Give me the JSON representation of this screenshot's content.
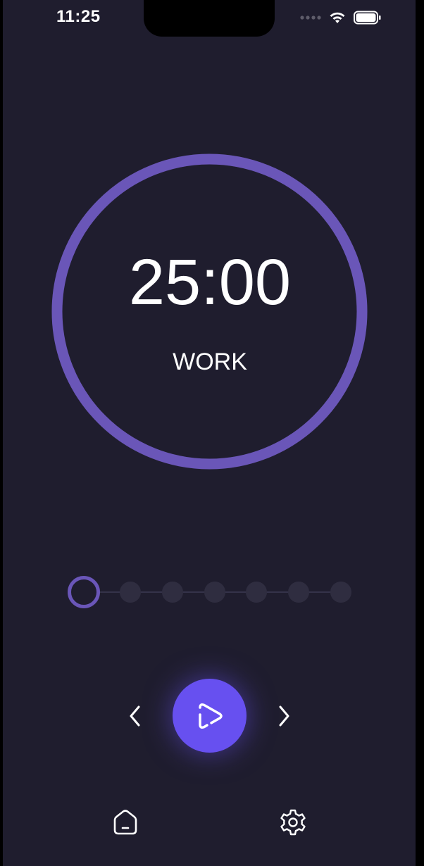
{
  "status_bar": {
    "time": "11:25",
    "icons": [
      "cellular-dots-icon",
      "wifi-icon",
      "battery-icon"
    ]
  },
  "timer": {
    "time_remaining": "25:00",
    "mode": "WORK",
    "progress": 1.0,
    "ring_color": "#6a56b8"
  },
  "sessions": {
    "total": 7,
    "current_index": 0
  },
  "controls": {
    "previous_icon": "chevron-left-icon",
    "play_icon": "play-icon",
    "next_icon": "chevron-right-icon",
    "accent_color": "#6750f0"
  },
  "bottom_nav": {
    "items": [
      {
        "icon": "home-icon"
      },
      {
        "icon": "settings-gear-icon"
      }
    ]
  },
  "colors": {
    "background": "#1f1d2e",
    "inactive_dot": "#2f2d40"
  }
}
